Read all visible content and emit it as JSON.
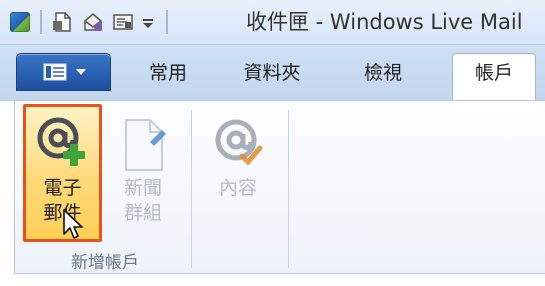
{
  "window": {
    "title": "收件匣 - Windows Live Mail"
  },
  "tabs": [
    {
      "label": "常用"
    },
    {
      "label": "資料夾"
    },
    {
      "label": "檢視"
    },
    {
      "label": "帳戶",
      "active": true
    }
  ],
  "ribbon": {
    "group_label": "新增帳戶",
    "buttons": {
      "email": {
        "label_line1": "電子",
        "label_line2": "郵件",
        "icon": "at-plus-icon",
        "highlighted": true
      },
      "newsgroup": {
        "label_line1": "新聞",
        "label_line2": "群組",
        "icon": "newsgroup-icon",
        "disabled": true
      },
      "properties": {
        "label": "內容",
        "icon": "at-check-icon",
        "disabled": true
      }
    }
  },
  "colors": {
    "highlight_border": "#e8531d",
    "app_menu": "#1d4f9e",
    "plus_green": "#3da63a",
    "check_orange": "#e58a2a"
  }
}
